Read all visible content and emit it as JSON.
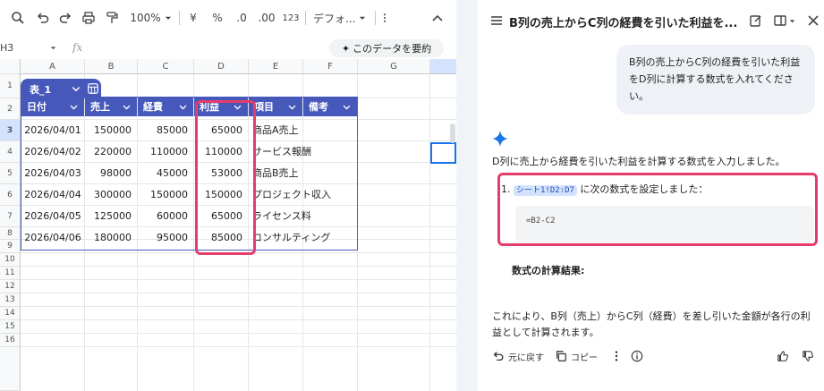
{
  "toolbar": {
    "zoom": "100%",
    "currency_symbol": "¥",
    "percent_symbol": "%",
    "decrease_decimal": ".0",
    "increase_decimal": ".00",
    "number_format": "123",
    "font": "デフォ..."
  },
  "formula_bar": {
    "cell_ref": "H3",
    "fx": "fx",
    "summarize_label": "このデータを要約"
  },
  "grid": {
    "columns": [
      "A",
      "B",
      "C",
      "D",
      "E",
      "F",
      "G"
    ],
    "rows": [
      "1",
      "2",
      "3",
      "4",
      "5",
      "6",
      "7",
      "8",
      "9",
      "10",
      "11",
      "12",
      "13",
      "14",
      "15",
      "16"
    ]
  },
  "table": {
    "name": "表_1",
    "headers": [
      "日付",
      "売上",
      "経費",
      "利益",
      "項目",
      "備考"
    ],
    "rows": [
      [
        "2026/04/01",
        "150000",
        "85000",
        "65000",
        "商品A売上",
        ""
      ],
      [
        "2026/04/02",
        "220000",
        "110000",
        "110000",
        "サービス報酬",
        ""
      ],
      [
        "2026/04/03",
        "98000",
        "45000",
        "53000",
        "商品B売上",
        ""
      ],
      [
        "2026/04/04",
        "300000",
        "150000",
        "150000",
        "プロジェクト収入",
        ""
      ],
      [
        "2026/04/05",
        "125000",
        "60000",
        "65000",
        "ライセンス料",
        ""
      ],
      [
        "2026/04/06",
        "180000",
        "95000",
        "85000",
        "コンサルティング",
        ""
      ]
    ]
  },
  "chat": {
    "title": "B列の売上からC列の経費を引いた利益を...",
    "user_message": "B列の売上からC列の経費を引いた利益をD列に計算する数式を入れてください。",
    "response_intro": "D列に売上から経費を引いた利益を計算する数式を入力しました。",
    "list_number": "1.",
    "range_ref": "シート1!D2:D7",
    "list_text": " に次の数式を設定しました：",
    "formula": "=B2-C2",
    "result_heading": "数式の計算結果:",
    "conclusion": "これにより、B列（売上）からC列（経費）を差し引いた金額が各行の利益として計算されます。",
    "undo_label": "元に戻す",
    "copy_label": "コピー"
  },
  "colors": {
    "table_header": "#4658ba",
    "highlight": "#e43d6d",
    "selection": "#1a73e8",
    "spark": "#1a73e8"
  }
}
